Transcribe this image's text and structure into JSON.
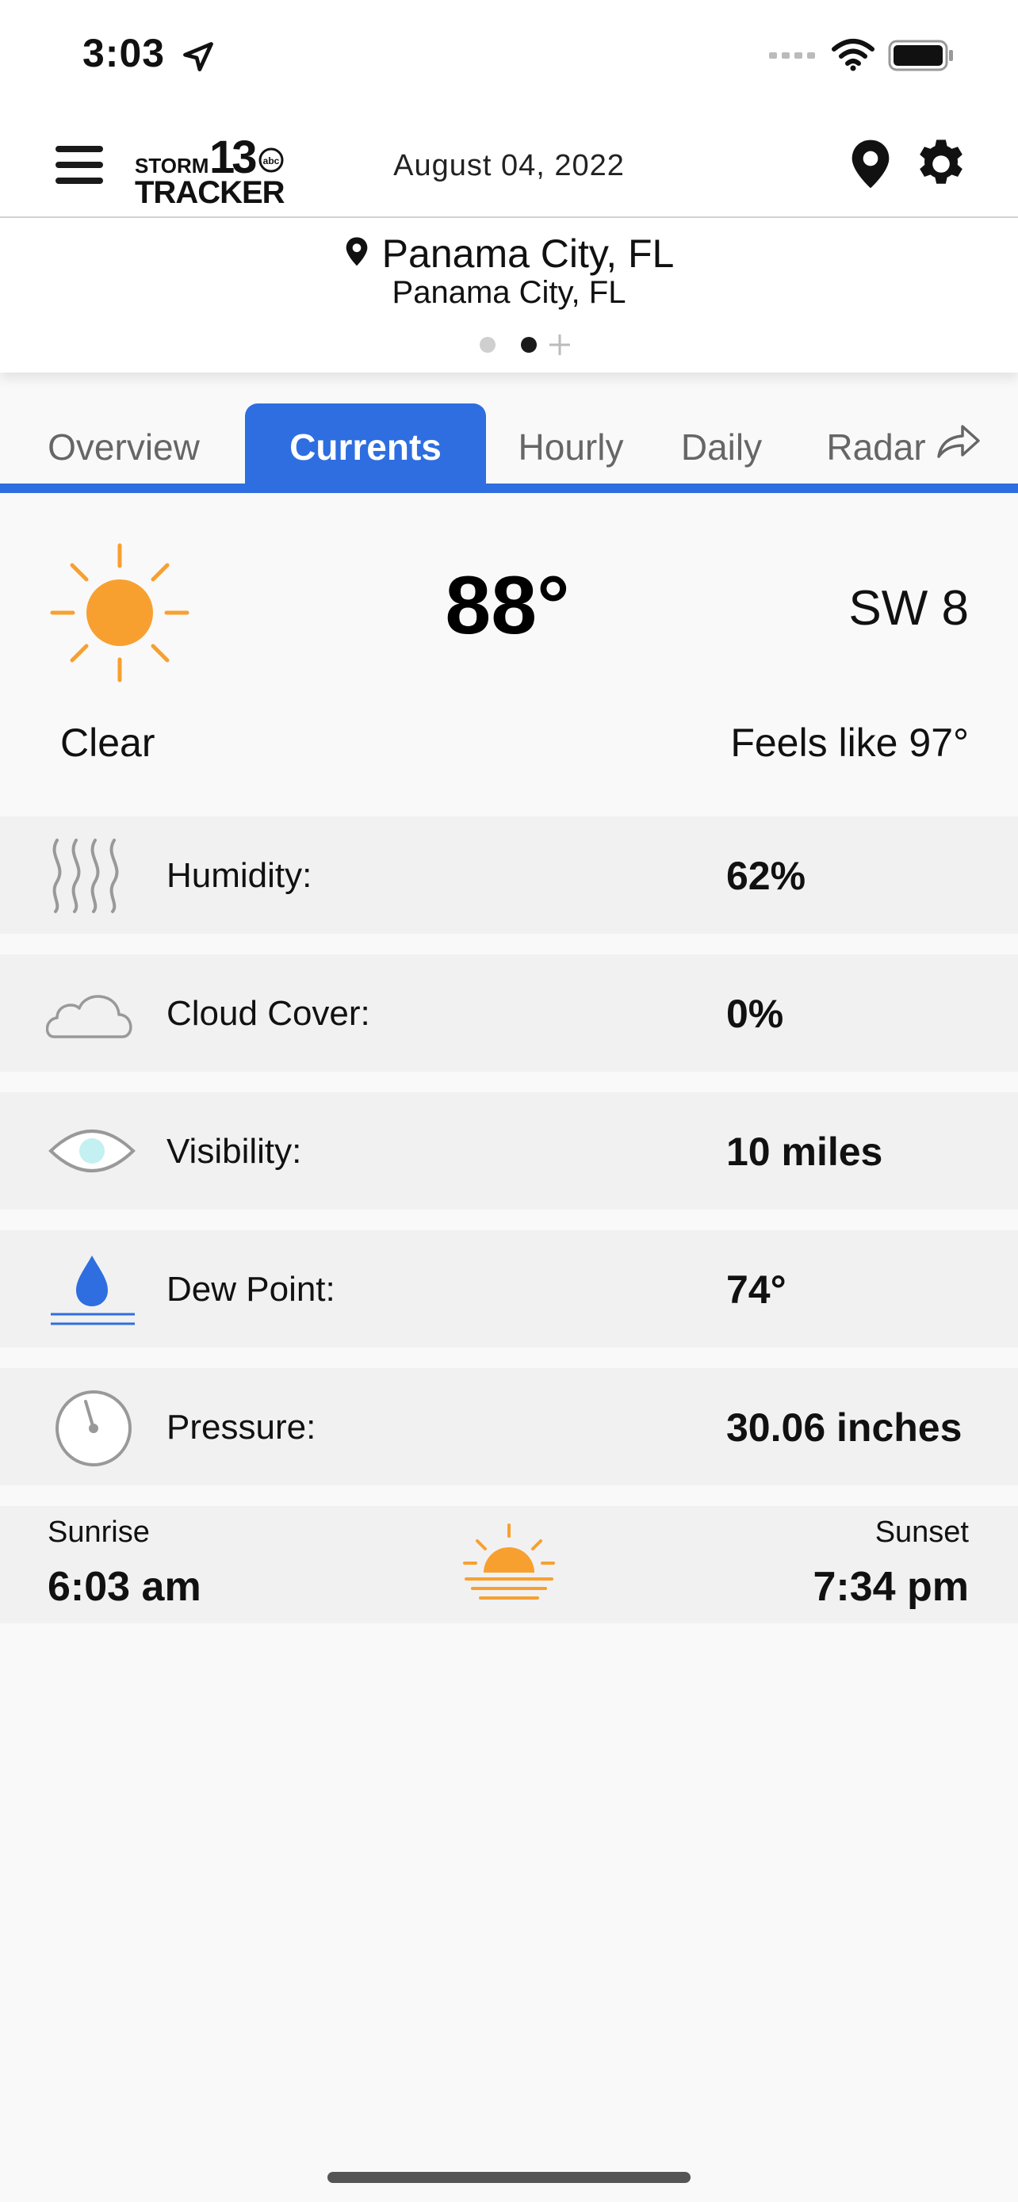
{
  "status_bar": {
    "time": "3:03"
  },
  "header": {
    "logo_line1": "STORM",
    "logo_number": "13",
    "logo_abc": "abc",
    "logo_line2": "TRACKER",
    "date": "August 04, 2022"
  },
  "location": {
    "name": "Panama City, FL",
    "subtitle": "Panama City, FL",
    "page_count": 2,
    "active_page": 2
  },
  "tabs": [
    {
      "label": "Overview",
      "active": false
    },
    {
      "label": "Currents",
      "active": true
    },
    {
      "label": "Hourly",
      "active": false
    },
    {
      "label": "Daily",
      "active": false
    },
    {
      "label": "Radar",
      "active": false
    }
  ],
  "current": {
    "icon": "sun-icon",
    "temperature": "88°",
    "wind": "SW 8",
    "condition": "Clear",
    "feels_like": "Feels like 97°"
  },
  "details": [
    {
      "icon": "humidity-icon",
      "label": "Humidity:",
      "value": "62%"
    },
    {
      "icon": "cloud-icon",
      "label": "Cloud Cover:",
      "value": "0%"
    },
    {
      "icon": "eye-icon",
      "label": "Visibility:",
      "value": "10 miles"
    },
    {
      "icon": "dew-drop-icon",
      "label": "Dew Point:",
      "value": "74°"
    },
    {
      "icon": "gauge-icon",
      "label": "Pressure:",
      "value": "30.06 inches"
    }
  ],
  "sun": {
    "sunrise_label": "Sunrise",
    "sunrise_time": "6:03 am",
    "sunset_label": "Sunset",
    "sunset_time": "7:34 pm"
  },
  "colors": {
    "accent": "#2e6ee0",
    "sun": "#f7a030",
    "dew": "#2e6ee0"
  }
}
